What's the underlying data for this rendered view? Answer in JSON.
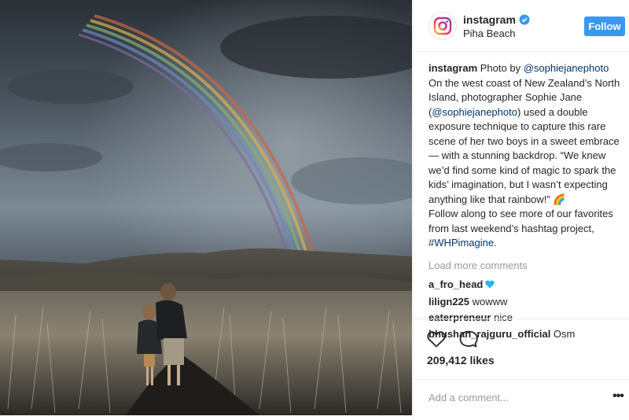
{
  "post": {
    "username": "instagram",
    "location": "Piha Beach",
    "follow_label": "Follow"
  },
  "caption": {
    "username": "instagram",
    "text_1": " Photo by ",
    "mention_1": "@sophiejanephoto",
    "text_2": " On the west coast of New Zealand’s North Island, photographer Sophie Jane (",
    "mention_2": "@sophiejanephoto",
    "text_3": ") used a double exposure technique to capture this rare scene of her two boys in a sweet embrace — with a stunning backdrop. “We knew we’d find some kind of magic to spark the kids’ imagination, but I wasn’t expecting anything like that rainbow!” 🌈",
    "text_4": "Follow along to see more of our favorites from last weekend’s hashtag project, ",
    "hashtag": "#WHPimagine",
    "text_5": "."
  },
  "load_more_label": "Load more comments",
  "comments": [
    {
      "username": "a_fro_head",
      "text": ""
    },
    {
      "username": "lilign225",
      "text": " wowww"
    },
    {
      "username": "eaterpreneur",
      "text": " nice"
    },
    {
      "username": "bhushan_rajguru_official",
      "text": " Osm"
    }
  ],
  "likes_label": "209,412 likes",
  "add_comment_placeholder": "Add a comment...",
  "more_label": "•••",
  "icons": {
    "like": "heart-outline-icon",
    "comment": "speech-bubble-icon",
    "verified": "verified-badge-icon",
    "comment_heart": "blue-heart-icon"
  },
  "colors": {
    "follow_button": "#3897f0",
    "link": "#003569",
    "verified": "#3897f0",
    "muted": "#999999"
  }
}
